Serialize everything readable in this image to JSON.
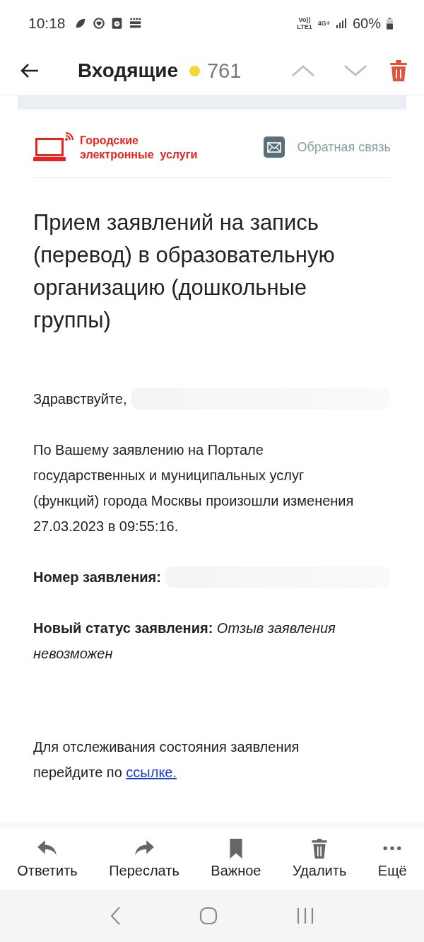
{
  "status_bar": {
    "time": "10:18",
    "network_labels": [
      "Vo))\nLTE1",
      "4G+"
    ],
    "battery": "60%"
  },
  "header": {
    "title": "Входящие",
    "unread_count": "761",
    "has_unread": true
  },
  "sender": {
    "logo_lines": [
      "Городские",
      "электронные  услуги"
    ],
    "feedback": "Обратная связь"
  },
  "email": {
    "subject": "Прием заявлений на запись (перевод) в образовательную организацию (дошкольные группы)",
    "blocks": [
      {
        "kind": "redacted",
        "text": "Здравствуйте,"
      },
      {
        "kind": "paragraph",
        "text": "По Вашему заявлению на Портале государственных и муниципальных услуг (функций) города Москвы произошли изменения 27.03.2023 в 09:55:16."
      },
      {
        "kind": "redacted",
        "text": "**Номер заявления:**"
      },
      {
        "kind": "paragraph",
        "text": "**Новый статус заявления:** *Отзыв заявления невозможен*"
      },
      {
        "kind": "link_paragraph",
        "text": "Для отслеживания состояния заявления перейдите по",
        "link": "ссылке."
      }
    ]
  },
  "toolbar": [
    {
      "kind": "reply",
      "label": "Ответить"
    },
    {
      "kind": "forward",
      "label": "Переслать"
    },
    {
      "kind": "bookmark",
      "label": "Важное"
    },
    {
      "kind": "delete",
      "label": "Удалить"
    },
    {
      "kind": "more",
      "label": "Ещё"
    }
  ]
}
